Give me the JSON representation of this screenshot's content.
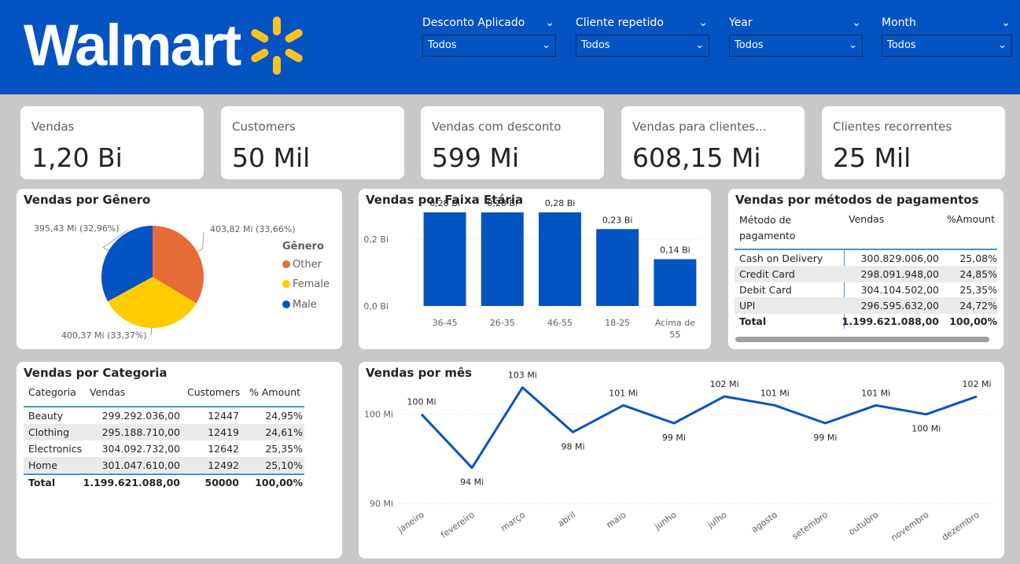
{
  "brand": {
    "name": "Walmart",
    "header_color": "#0353c3",
    "spark_color": "#ffc220"
  },
  "filters": [
    {
      "title": "Desconto Aplicado",
      "value": "Todos"
    },
    {
      "title": "Cliente repetido",
      "value": "Todos"
    },
    {
      "title": "Year",
      "value": "Todos"
    },
    {
      "title": "Month",
      "value": "Todos"
    }
  ],
  "kpis": [
    {
      "label": "Vendas",
      "value": "1,20 Bi"
    },
    {
      "label": "Customers",
      "value": "50 Mil"
    },
    {
      "label": "Vendas com desconto",
      "value": "599 Mi"
    },
    {
      "label": "Vendas para clientes...",
      "value": "608,15 Mi"
    },
    {
      "label": "Clientes recorrentes",
      "value": "25 Mil"
    }
  ],
  "gender_panel": {
    "title": "Vendas por Gênero",
    "legend_title": "Gênero"
  },
  "age_panel": {
    "title": "Vendas por Faixa Etária"
  },
  "payment_panel": {
    "title": "Vendas por métodos de pagamentos",
    "headers": [
      "Método de pagamento",
      "Vendas",
      "%Amount"
    ],
    "rows": [
      [
        "Cash on Delivery",
        "300.829.006,00",
        "25,08%"
      ],
      [
        "Credit Card",
        "298.091.948,00",
        "24,85%"
      ],
      [
        "Debit Card",
        "304.104.502,00",
        "25,35%"
      ],
      [
        "UPI",
        "296.595.632,00",
        "24,72%"
      ]
    ],
    "total": [
      "Total",
      "1.199.621.088,00",
      "100,00%"
    ]
  },
  "category_panel": {
    "title": "Vendas por Categoria",
    "headers": [
      "Categoria",
      "Vendas",
      "Customers",
      "% Amount"
    ],
    "rows": [
      [
        "Beauty",
        "299.292.036,00",
        "12447",
        "24,95%"
      ],
      [
        "Clothing",
        "295.188.710,00",
        "12419",
        "24,61%"
      ],
      [
        "Electronics",
        "304.092.732,00",
        "12642",
        "25,35%"
      ],
      [
        "Home",
        "301.047.610,00",
        "12492",
        "25,10%"
      ]
    ],
    "total": [
      "Total",
      "1.199.621.088,00",
      "50000",
      "100,00%"
    ]
  },
  "month_panel": {
    "title": "Vendas por mês"
  },
  "chart_data": [
    {
      "type": "pie",
      "title": "Vendas por Gênero",
      "legend_title": "Gênero",
      "legend_placement": "right",
      "categories": [
        "Other",
        "Female",
        "Male"
      ],
      "values": [
        403.82,
        400.37,
        395.43
      ],
      "labels": [
        "403,82 Mi (33,66%)",
        "400,37 Mi (33,37%)",
        "395,43 Mi (32,96%)"
      ],
      "colors": [
        "#e66c37",
        "#ffcc00",
        "#0353c3"
      ]
    },
    {
      "type": "bar",
      "title": "Vendas por Faixa Etária",
      "categories": [
        "36-45",
        "26-35",
        "46-55",
        "18-25",
        "Acima de 55"
      ],
      "values": [
        0.28,
        0.28,
        0.28,
        0.23,
        0.14
      ],
      "labels": [
        "0,28 Bi",
        "0,28 Bi",
        "0,28 Bi",
        "0,23 Bi",
        "0,14 Bi"
      ],
      "ylim": [
        0,
        0.32
      ],
      "yticks": [
        0,
        0.2
      ],
      "ytick_labels": [
        "0,0 Bi",
        "0,2 Bi"
      ],
      "color": "#0353c3",
      "grid": true
    },
    {
      "type": "line",
      "title": "Vendas por mês",
      "categories": [
        "janeiro",
        "fevereiro",
        "março",
        "abril",
        "maio",
        "junho",
        "julho",
        "agosto",
        "setembro",
        "outubro",
        "novembro",
        "dezembro"
      ],
      "values": [
        100,
        94,
        103,
        98,
        101,
        99,
        102,
        101,
        99,
        101,
        100,
        102
      ],
      "labels": [
        "100 Mi",
        "94 Mi",
        "103 Mi",
        "98 Mi",
        "101 Mi",
        "99 Mi",
        "102 Mi",
        "101 Mi",
        "99 Mi",
        "101 Mi",
        "100 Mi",
        "102 Mi"
      ],
      "ylim": [
        90,
        105
      ],
      "yticks": [
        90,
        100
      ],
      "ytick_labels": [
        "90 Mi",
        "100 Mi"
      ],
      "color": "#0353c3",
      "grid": true
    }
  ]
}
